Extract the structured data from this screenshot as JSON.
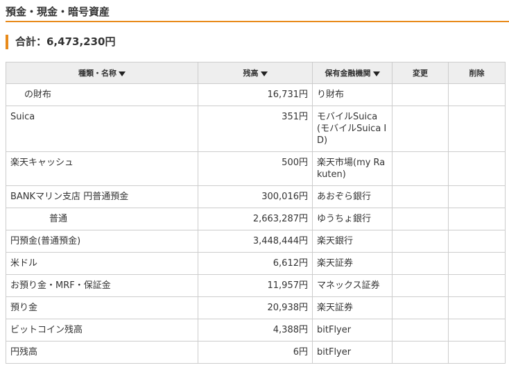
{
  "section": {
    "title": "預金・現金・暗号資産"
  },
  "total": {
    "text": "合計：6,473,230円"
  },
  "table": {
    "headers": {
      "name": "種類・名称",
      "balance": "残高",
      "institution": "保有金融機関",
      "edit": "変更",
      "delete": "削除"
    },
    "rows": [
      {
        "name": "の財布",
        "balance": "16,731円",
        "institution": "り財布"
      },
      {
        "name": "Suica",
        "balance": "351円",
        "institution": "モバイルSuica(モバイルSuica ID)"
      },
      {
        "name": "楽天キャッシュ",
        "balance": "500円",
        "institution": "楽天市場(my Rakuten)"
      },
      {
        "name": "BANKマリン支店 円普通預金",
        "balance": "300,016円",
        "institution": "あおぞら銀行"
      },
      {
        "name": "普通",
        "balance": "2,663,287円",
        "institution": "ゆうちょ銀行"
      },
      {
        "name": "円預金(普通預金)",
        "balance": "3,448,444円",
        "institution": "楽天銀行"
      },
      {
        "name": "米ドル",
        "balance": "6,612円",
        "institution": "楽天証券"
      },
      {
        "name": "お預り金・MRF・保証金",
        "balance": "11,957円",
        "institution": "マネックス証券"
      },
      {
        "name": "預り金",
        "balance": "20,938円",
        "institution": "楽天証券"
      },
      {
        "name": "ビットコイン残高",
        "balance": "4,388円",
        "institution": "bitFlyer"
      },
      {
        "name": "円残高",
        "balance": "6円",
        "institution": "bitFlyer"
      }
    ]
  },
  "colors": {
    "accent": "#e88a1a",
    "header_bg": "#eeeeee",
    "border": "#cccccc"
  },
  "icons": {
    "sort": "sort-desc-icon"
  }
}
